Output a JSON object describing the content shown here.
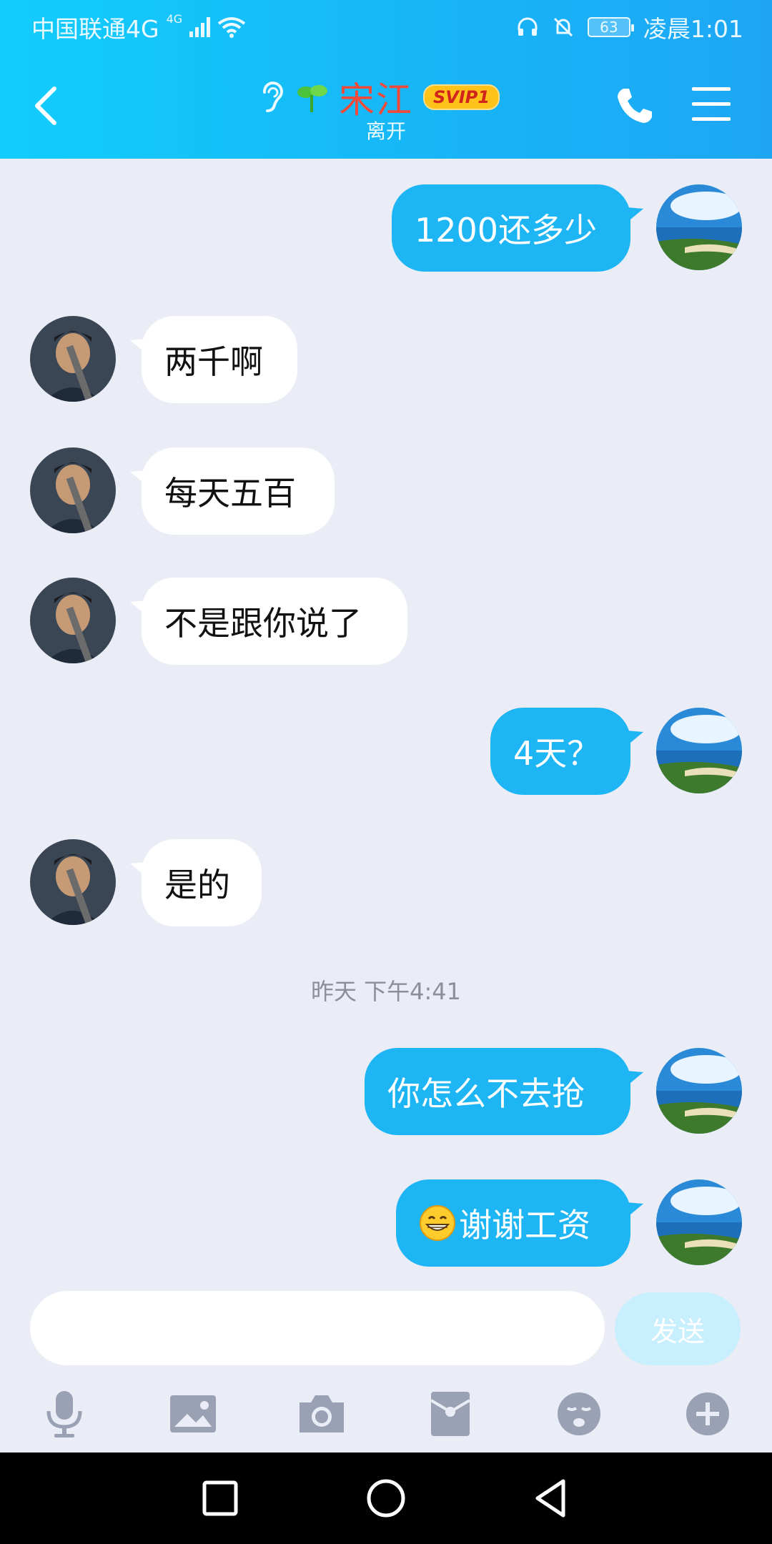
{
  "status_bar": {
    "carrier": "中国联通4G",
    "net_small": "4G",
    "battery": "63",
    "time": "凌晨1:01"
  },
  "header": {
    "contact_name": "宋江",
    "badge": "SVIP1",
    "status": "离开"
  },
  "messages": [
    {
      "from": "me",
      "text": "1200还多少"
    },
    {
      "from": "other",
      "text": "两千啊"
    },
    {
      "from": "other",
      "text": "每天五百"
    },
    {
      "from": "other",
      "text": "不是跟你说了"
    },
    {
      "from": "me",
      "text": "4天？"
    },
    {
      "from": "other",
      "text": "是的"
    },
    {
      "from": "me",
      "text": "你怎么不去抢"
    },
    {
      "from": "me",
      "text": "谢谢工资",
      "emoji": "grin-emoji"
    }
  ],
  "timestamp": "昨天 下午4:41",
  "composer": {
    "placeholder": "",
    "send_label": "发送"
  },
  "toolbar_icons": [
    "microphone-icon",
    "image-icon",
    "camera-icon",
    "red-packet-icon",
    "emoji-icon",
    "plus-icon"
  ],
  "colors": {
    "header_start": "#12cdfd",
    "header_end": "#1ea6f5",
    "bubble_me": "#1eb5f5",
    "bubble_other": "#ffffff",
    "chat_bg": "#eaedf5",
    "name_color": "#f04a3a"
  }
}
